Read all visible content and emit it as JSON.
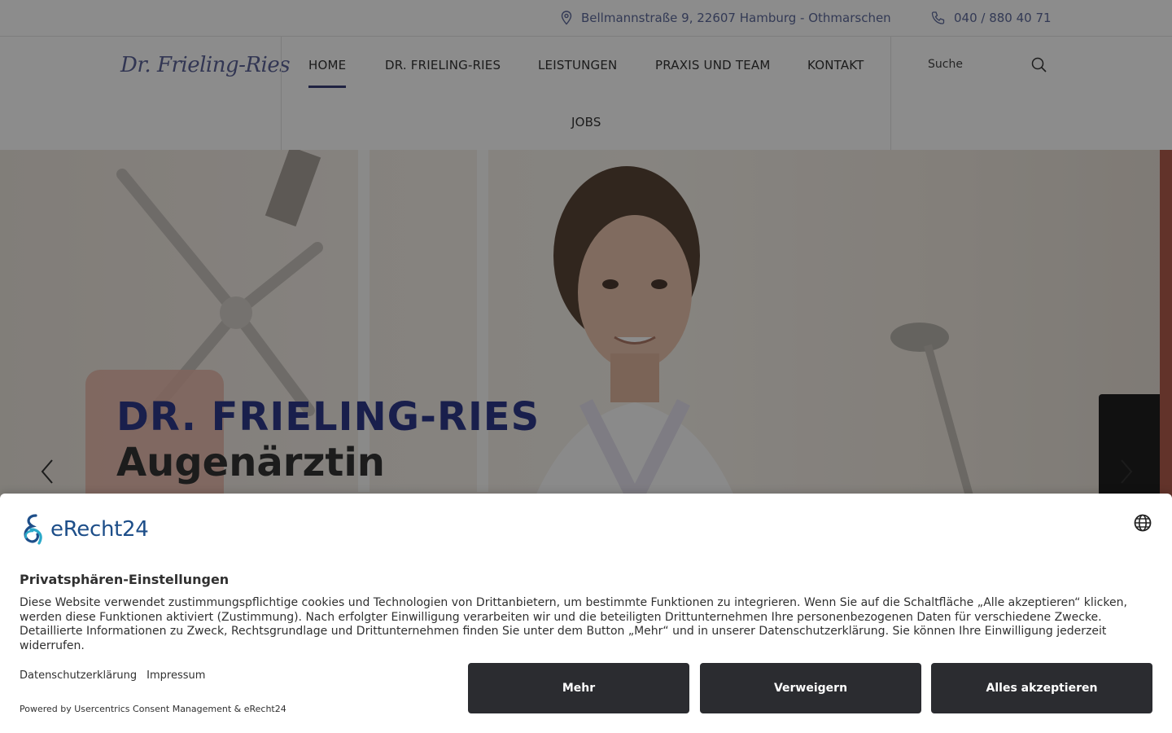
{
  "topbar": {
    "address": "Bellmannstraße 9, 22607 Hamburg - Othmarschen",
    "address_icon": "map-pin-icon",
    "phone": "040 / 880 40 71",
    "phone_icon": "phone-icon"
  },
  "header": {
    "logo_text": "Dr. Frieling-Ries",
    "nav": [
      {
        "label": "HOME",
        "active": true
      },
      {
        "label": "DR. FRIELING-RIES"
      },
      {
        "label": "LEISTUNGEN"
      },
      {
        "label": "PRAXIS UND TEAM"
      },
      {
        "label": "KONTAKT"
      },
      {
        "label": "JOBS"
      }
    ],
    "search_placeholder": "Suche",
    "search_icon": "search-icon"
  },
  "hero": {
    "title": "DR. FRIELING-RIES",
    "subtitle": "Augenärztin",
    "prev_icon": "chevron-left-icon",
    "next_icon": "chevron-right-icon"
  },
  "consent": {
    "brand": "eRecht24",
    "language_icon": "globe-icon",
    "heading": "Privatsphären-Einstellungen",
    "description": "Diese Website verwendet zustimmungspflichtige cookies und Technologien von Drittanbietern, um bestimmte Funktionen zu integrieren. Wenn Sie auf die Schaltfläche „Alle akzeptieren“ klicken, werden diese Funktionen aktiviert (Zustimmung). Nach erfolgter Einwilligung verarbeiten wir und die beteiligten Drittunternehmen Ihre personenbezogenen Daten für verschiedene Zwecke. Detaillierte Informationen zu Zweck, Rechtsgrundlage und Drittunternehmen finden Sie unter dem Button „Mehr“ und in unserer Datenschutzerklärung. Sie können Ihre Einwilligung jederzeit widerrufen.",
    "link_privacy": "Datenschutzerklärung",
    "link_imprint": "Impressum",
    "powered_by": "Powered by Usercentrics Consent Management & eRecht24",
    "btn_more": "Mehr",
    "btn_deny": "Verweigern",
    "btn_accept": "Alles akzeptieren"
  },
  "colors": {
    "accent": "#2f3a8a",
    "button": "#2b2c30",
    "brand": "#1d4e89"
  }
}
